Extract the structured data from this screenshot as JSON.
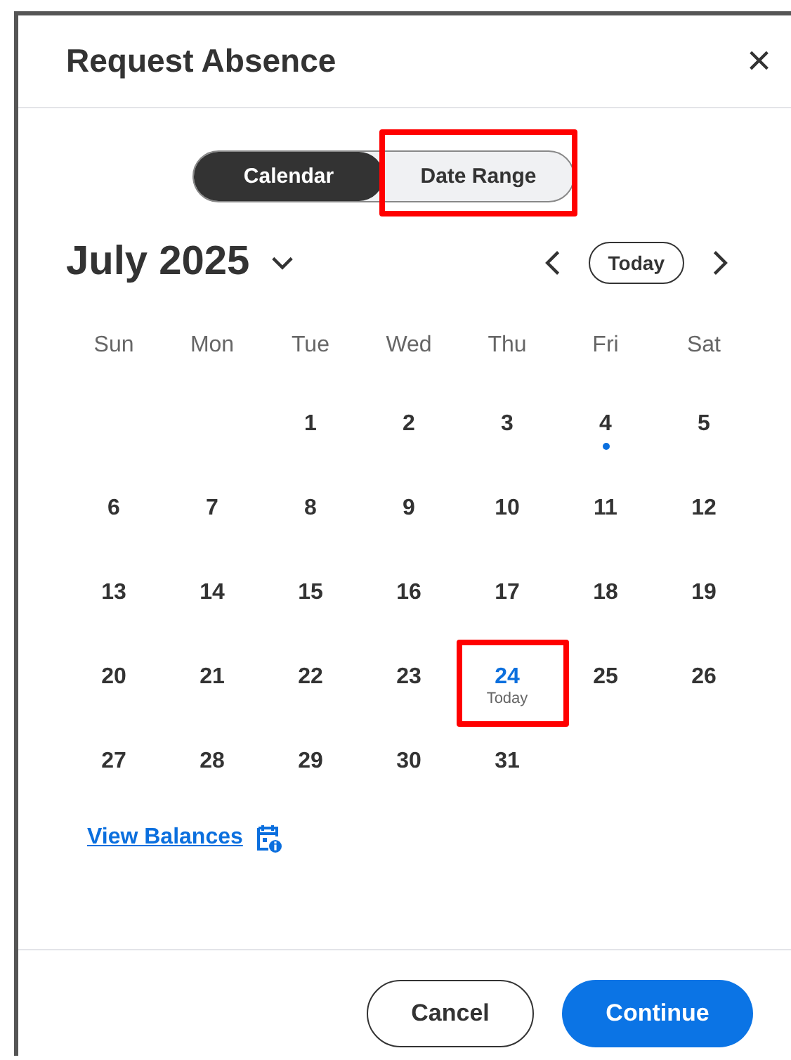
{
  "dialog": {
    "title": "Request Absence",
    "close": "×"
  },
  "view_toggle": [
    {
      "label": "Calendar",
      "selected": true,
      "highlighted": false
    },
    {
      "label": "Date Range",
      "selected": false,
      "highlighted": true
    }
  ],
  "month": {
    "label": "July 2025",
    "today_button": "Today"
  },
  "weekdays": [
    "Sun",
    "Mon",
    "Tue",
    "Wed",
    "Thu",
    "Fri",
    "Sat"
  ],
  "weeks": [
    [
      {
        "kind": "blank"
      },
      {
        "kind": "blank"
      },
      {
        "kind": "day",
        "day": "1"
      },
      {
        "kind": "day",
        "day": "2"
      },
      {
        "kind": "day",
        "day": "3"
      },
      {
        "kind": "day",
        "day": "4",
        "marked": true
      },
      {
        "kind": "day",
        "day": "5"
      }
    ],
    [
      {
        "kind": "day",
        "day": "6"
      },
      {
        "kind": "day",
        "day": "7"
      },
      {
        "kind": "day",
        "day": "8"
      },
      {
        "kind": "day",
        "day": "9"
      },
      {
        "kind": "day",
        "day": "10"
      },
      {
        "kind": "day",
        "day": "11"
      },
      {
        "kind": "day",
        "day": "12"
      }
    ],
    [
      {
        "kind": "day",
        "day": "13"
      },
      {
        "kind": "day",
        "day": "14"
      },
      {
        "kind": "day",
        "day": "15"
      },
      {
        "kind": "day",
        "day": "16"
      },
      {
        "kind": "day",
        "day": "17"
      },
      {
        "kind": "day",
        "day": "18"
      },
      {
        "kind": "day",
        "day": "19"
      }
    ],
    [
      {
        "kind": "day",
        "day": "20"
      },
      {
        "kind": "day",
        "day": "21"
      },
      {
        "kind": "day",
        "day": "22"
      },
      {
        "kind": "day",
        "day": "23"
      },
      {
        "kind": "day",
        "day": "24",
        "today": true,
        "sublabel": "Today",
        "highlighted": true
      },
      {
        "kind": "day",
        "day": "25"
      },
      {
        "kind": "day",
        "day": "26"
      }
    ],
    [
      {
        "kind": "day",
        "day": "27"
      },
      {
        "kind": "day",
        "day": "28"
      },
      {
        "kind": "day",
        "day": "29"
      },
      {
        "kind": "day",
        "day": "30"
      },
      {
        "kind": "day",
        "day": "31"
      },
      {
        "kind": "blank"
      },
      {
        "kind": "blank"
      }
    ]
  ],
  "link": "View Balances",
  "buttons": [
    {
      "label": "Cancel",
      "kind": "secondary"
    },
    {
      "label": "Continue",
      "kind": "primary"
    }
  ]
}
